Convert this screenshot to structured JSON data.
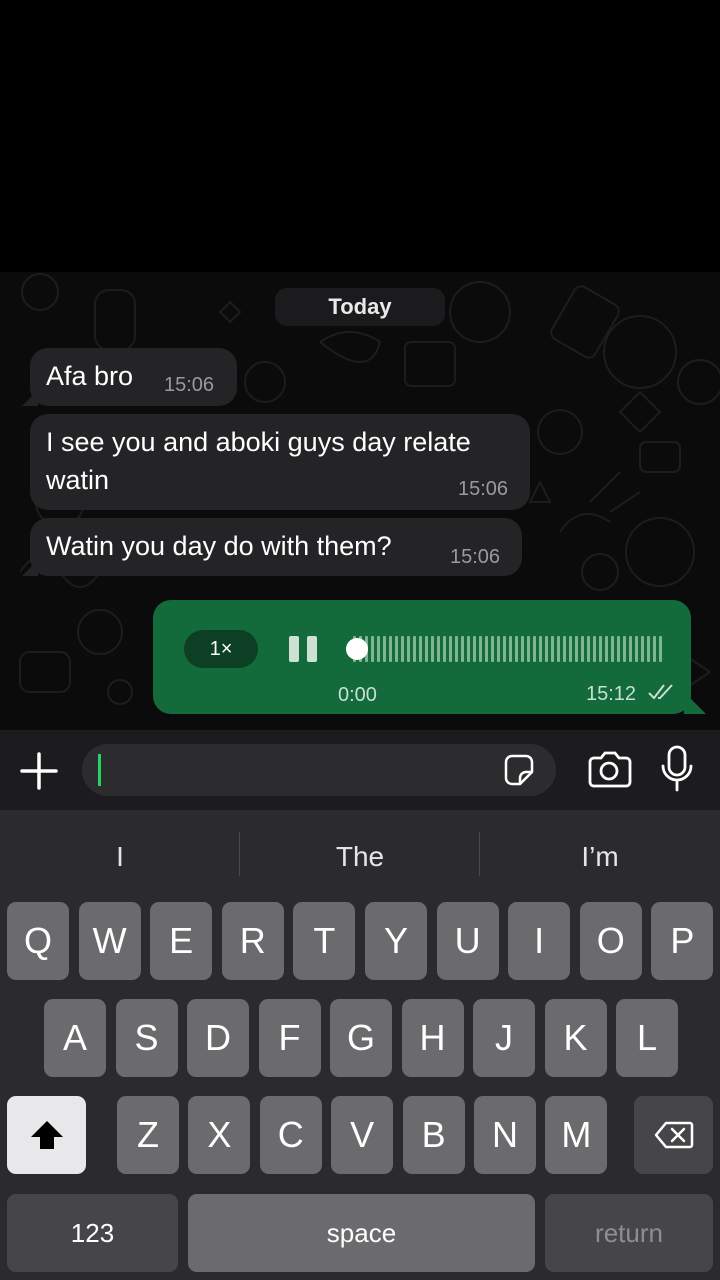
{
  "chat": {
    "date_label": "Today",
    "messages": [
      {
        "text": "Afa bro",
        "time": "15:06"
      },
      {
        "text_line1": "I see you and aboki guys day relate",
        "text_line2": "watin",
        "time": "15:06"
      },
      {
        "text": "Watin you day do with them?",
        "time": "15:06"
      }
    ],
    "voice_note": {
      "speed": "1×",
      "duration": "0:00",
      "time": "15:12",
      "status_icon": "double-check-icon",
      "progress": 0
    }
  },
  "input": {
    "plus_icon": "plus-icon",
    "sticker_icon": "sticker-icon",
    "camera_icon": "camera-icon",
    "mic_icon": "microphone-icon",
    "placeholder": ""
  },
  "keyboard": {
    "suggestions": [
      "I",
      "The",
      "I’m"
    ],
    "row1": [
      "Q",
      "W",
      "E",
      "R",
      "T",
      "Y",
      "U",
      "I",
      "O",
      "P"
    ],
    "row2": [
      "A",
      "S",
      "D",
      "F",
      "G",
      "H",
      "J",
      "K",
      "L"
    ],
    "row3": [
      "Z",
      "X",
      "C",
      "V",
      "B",
      "N",
      "M"
    ],
    "numbers_label": "123",
    "space_label": "space",
    "return_label": "return",
    "shift_icon": "shift-icon",
    "delete_icon": "delete-icon"
  },
  "colors": {
    "outgoing_bubble": "#136b3c",
    "incoming_bubble": "#242426",
    "accent": "#25d366",
    "keyboard_bg": "#2b2b2d"
  }
}
